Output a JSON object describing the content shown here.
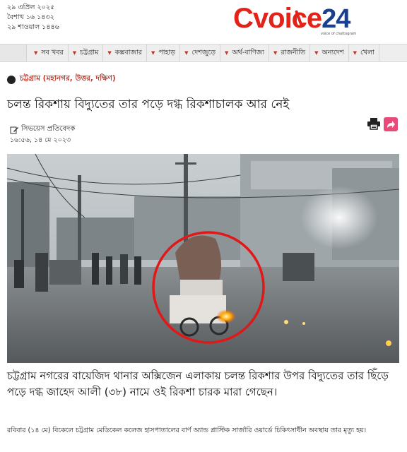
{
  "header": {
    "date_bangla": "২৯ এপ্রিল ২০২৫",
    "date_bengali": "বৈশাখ ১৬ ১৪৩২",
    "date_hijri": "২৯ শাওয়াল ১৪৪৬",
    "logo_text": "Cvoice",
    "logo_number": "24",
    "logo_tagline": "voice of chattogram"
  },
  "nav": {
    "items": [
      {
        "label": "সব খবর"
      },
      {
        "label": "চট্টগ্রাম"
      },
      {
        "label": "কক্সবাজার"
      },
      {
        "label": "পাহাড়"
      },
      {
        "label": "দেশজুড়ে"
      },
      {
        "label": "অর্থ-বাণিজ্য"
      },
      {
        "label": "রাজনীতি"
      },
      {
        "label": "অন্যদেশ"
      },
      {
        "label": "খেলা"
      }
    ]
  },
  "article": {
    "category": "চট্টগ্রাম (মহানগর, উত্তর, দক্ষিণ)",
    "headline": "চলন্ত রিকশায় বিদ্যুতের তার পড়ে দগ্ধ রিকশাচালক আর নেই",
    "author": "সিভয়েস প্রতিবেদক",
    "timestamp": "১৬:৫৬, ১৪ মে ২০২৩",
    "lead": "চট্টগ্রাম নগরের বায়েজিদ থানার অক্সিজেন এলাকায় চলন্ত রিকশার উপর বিদ্যুতের তার ছিঁড়ে পড়ে দগ্ধ জাহেদ আলী (৩৮) নামে ওই রিকশা চারক মারা গেছেন।",
    "body": "রবিবার (১৪ মে) বিকেলে চট্টগ্রাম মেডিকেল কলেজ হাসপাতালের বার্ণ অ্যান্ড প্লাস্টিক সার্জারি ওয়ার্ডে চিকিৎসাধীন অবস্থায় তার মৃত্যু হয়।"
  },
  "colors": {
    "brand_red": "#e2231a",
    "brand_blue": "#1b3f8f",
    "category_red": "#c0392b",
    "highlight_circle": "#e01818"
  },
  "icons": {
    "byline": "pen-icon",
    "print": "print-icon",
    "share": "share-icon",
    "nav_caret": "caret-down-icon"
  }
}
